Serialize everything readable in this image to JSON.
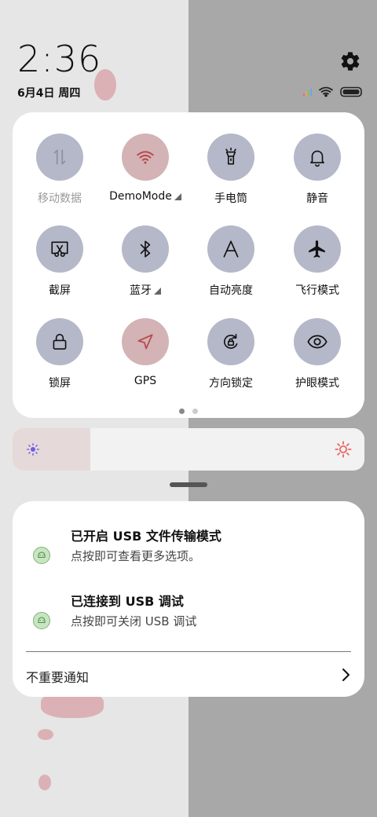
{
  "status_bar": {
    "time": "2:36",
    "date": "6月4日 周四",
    "settings_icon": "gear-icon",
    "signal_icon": "signal-icon",
    "wifi_icon": "wifi-icon",
    "battery_icon": "battery-icon"
  },
  "quick_settings": {
    "tiles": [
      {
        "label": "移动数据",
        "icon": "mobile-data-icon",
        "state": "disabled"
      },
      {
        "label": "DemoMode",
        "icon": "wifi-icon",
        "state": "active",
        "has_menu": true
      },
      {
        "label": "手电筒",
        "icon": "flashlight-icon",
        "state": "off"
      },
      {
        "label": "静音",
        "icon": "bell-icon",
        "state": "off"
      },
      {
        "label": "截屏",
        "icon": "screenshot-icon",
        "state": "off"
      },
      {
        "label": "蓝牙",
        "icon": "bluetooth-icon",
        "state": "off",
        "has_menu": true
      },
      {
        "label": "自动亮度",
        "icon": "auto-brightness-icon",
        "state": "off"
      },
      {
        "label": "飞行模式",
        "icon": "airplane-icon",
        "state": "off"
      },
      {
        "label": "锁屏",
        "icon": "lock-icon",
        "state": "off"
      },
      {
        "label": "GPS",
        "icon": "location-arrow-icon",
        "state": "active"
      },
      {
        "label": "方向锁定",
        "icon": "rotation-lock-icon",
        "state": "off"
      },
      {
        "label": "护眼模式",
        "icon": "eye-icon",
        "state": "off"
      }
    ],
    "page_count": 2,
    "current_page": 1
  },
  "brightness": {
    "level": 0.22,
    "low_icon": "brightness-low-icon",
    "high_icon": "brightness-high-icon"
  },
  "notifications": [
    {
      "title": "已开启 USB 文件传输模式",
      "subtitle": "点按即可查看更多选项。",
      "icon": "android-icon"
    },
    {
      "title": "已连接到 USB 调试",
      "subtitle": "点按即可关闭 USB 调试",
      "icon": "android-icon"
    }
  ],
  "unimportant_label": "不重要通知",
  "colors": {
    "tile_off": "#b4b8c8",
    "tile_active": "#d3b3b5",
    "active_icon": "#b8474b",
    "accent_red": "#e8675f",
    "accent_purple": "#6d5ce6"
  }
}
